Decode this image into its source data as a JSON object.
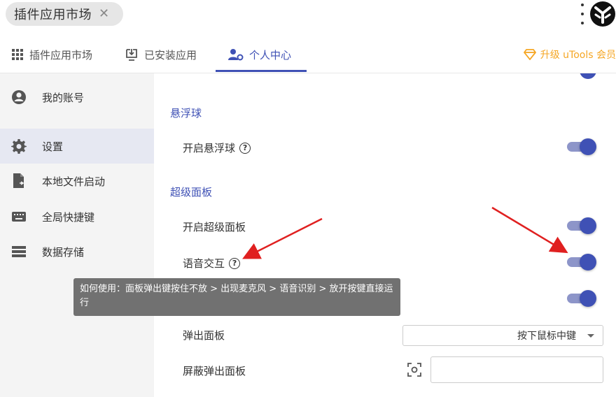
{
  "topbar": {
    "search_chip_text": "插件应用市场",
    "close_glyph": "✕"
  },
  "tabs": [
    {
      "label": "插件应用市场",
      "icon": "grid-icon"
    },
    {
      "label": "已安装应用",
      "icon": "install-icon"
    },
    {
      "label": "个人中心",
      "icon": "user-settings-icon",
      "active": true
    }
  ],
  "upgrade": {
    "label": "升级 uTools 会员",
    "icon": "diamond-icon",
    "color": "#f5a623"
  },
  "sidebar": {
    "items": [
      {
        "label": "我的账号",
        "icon": "account-icon"
      },
      {
        "label": "设置",
        "icon": "gear-icon",
        "active": true
      },
      {
        "label": "本地文件启动",
        "icon": "file-shortcut-icon"
      },
      {
        "label": "全局快捷键",
        "icon": "keyboard-icon"
      },
      {
        "label": "数据存储",
        "icon": "storage-icon"
      }
    ]
  },
  "content": {
    "floating_ball": {
      "title": "悬浮球",
      "enable_label": "开启悬浮球",
      "enable_on": true
    },
    "super_panel": {
      "title": "超级面板",
      "enable_label": "开启超级面板",
      "enable_on": true,
      "voice_label": "语音交互",
      "voice_on": true,
      "third_toggle_on": true,
      "popup_label": "弹出面板",
      "popup_value": "按下鼠标中键",
      "block_label": "屏蔽弹出面板",
      "block_value": ""
    },
    "help_glyph": "?"
  },
  "tooltip": {
    "text": "如何使用：面板弹出键按住不放 > 出现麦克风 > 语音识别 > 放开按键直接运行"
  },
  "colors": {
    "accent": "#3f51b5",
    "toggle_track": "#8d95c9",
    "arrow": "#e02020"
  }
}
